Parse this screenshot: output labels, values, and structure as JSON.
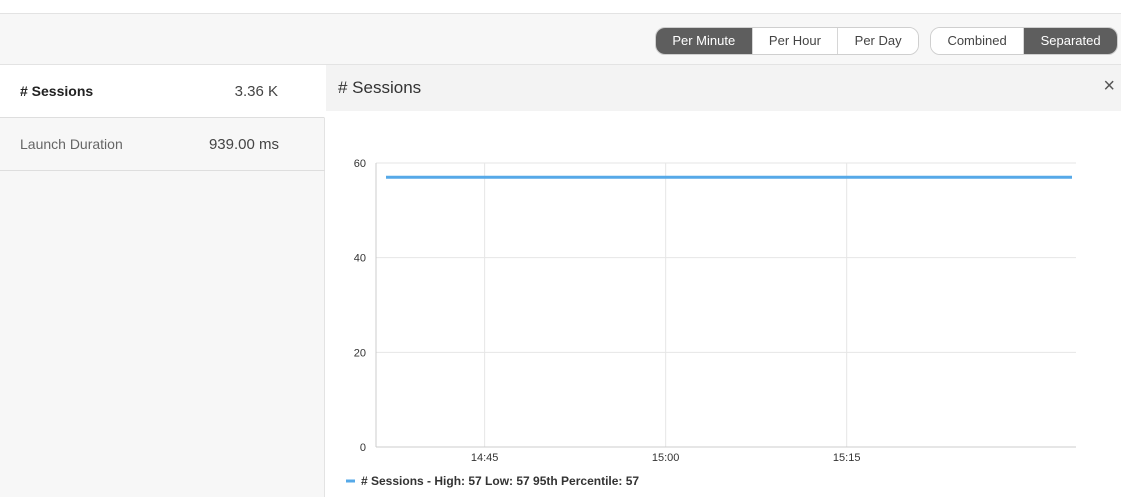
{
  "toolbar": {
    "time_buttons": [
      {
        "label": "Per Minute",
        "active": true
      },
      {
        "label": "Per Hour",
        "active": false
      },
      {
        "label": "Per Day",
        "active": false
      }
    ],
    "view_buttons": [
      {
        "label": "Combined",
        "active": false
      },
      {
        "label": "Separated",
        "active": true
      }
    ]
  },
  "metrics": [
    {
      "label": "# Sessions",
      "value": "3.36 K",
      "selected": true
    },
    {
      "label": "Launch Duration",
      "value": "939.00 ms",
      "selected": false
    }
  ],
  "panel": {
    "title": "# Sessions",
    "close_icon": "close-icon",
    "close_glyph": "×"
  },
  "colors": {
    "accent_line": "#56a9e8",
    "active_button": "#5e5e5e"
  },
  "chart_data": {
    "type": "line",
    "title": "# Sessions",
    "xlabel": "",
    "ylabel": "",
    "ylim": [
      0,
      60
    ],
    "y_ticks": [
      0,
      20,
      40,
      60
    ],
    "x_ticks": [
      "14:45",
      "15:00",
      "15:15"
    ],
    "grid": true,
    "legend_placement": "bottom-left",
    "series": [
      {
        "name": "# Sessions",
        "legend_label": "# Sessions - High: 57 Low: 57 95th Percentile: 57",
        "x_start": "14:36",
        "x_end": "15:34",
        "values": [
          57,
          57
        ]
      }
    ],
    "x_range": [
      "14:36",
      "15:34"
    ]
  }
}
